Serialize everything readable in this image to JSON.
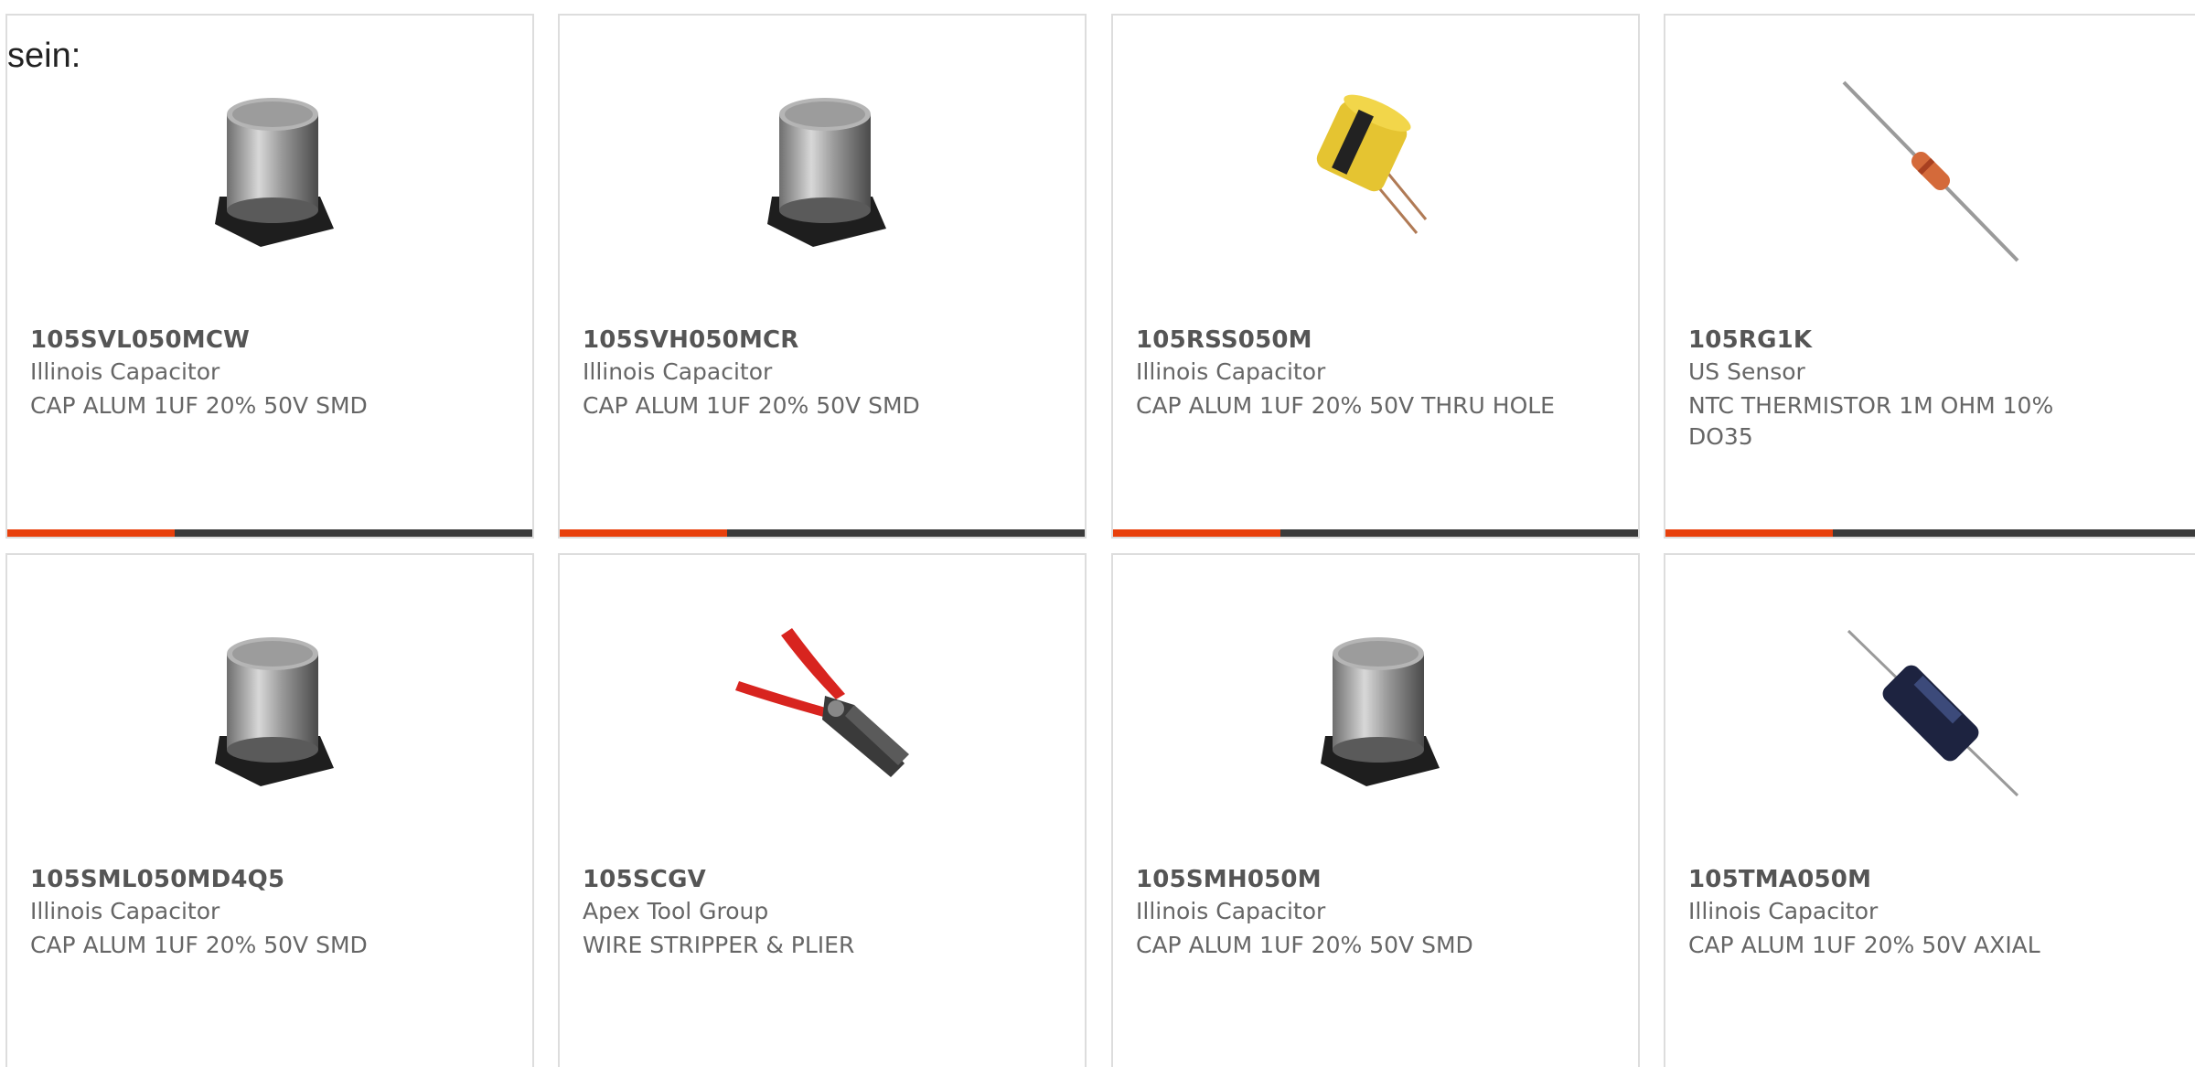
{
  "intro_text": "sein:",
  "colors": {
    "accent": "#e8400c",
    "bar_dark": "#3b3b3b",
    "border": "#dddddd"
  },
  "products": [
    {
      "part": "105SVL050MCW",
      "mfr": "Illinois Capacitor",
      "desc": "CAP ALUM 1UF 20% 50V SMD",
      "image": "smd-capacitor-image"
    },
    {
      "part": "105SVH050MCR",
      "mfr": "Illinois Capacitor",
      "desc": "CAP ALUM 1UF 20% 50V SMD",
      "image": "smd-capacitor-image"
    },
    {
      "part": "105RSS050M",
      "mfr": "Illinois Capacitor",
      "desc": "CAP ALUM 1UF 20% 50V THRU HOLE",
      "image": "radial-capacitor-image"
    },
    {
      "part": "105RG1K",
      "mfr": "US Sensor",
      "desc": "NTC THERMISTOR 1M OHM 10% DO35",
      "image": "thermistor-image"
    },
    {
      "part": "105SML050MD4Q5",
      "mfr": "Illinois Capacitor",
      "desc": "CAP ALUM 1UF 20% 50V SMD",
      "image": "smd-capacitor-image"
    },
    {
      "part": "105SCGV",
      "mfr": "Apex Tool Group",
      "desc": "WIRE STRIPPER & PLIER",
      "image": "wire-stripper-image"
    },
    {
      "part": "105SMH050M",
      "mfr": "Illinois Capacitor",
      "desc": "CAP ALUM 1UF 20% 50V SMD",
      "image": "smd-capacitor-image"
    },
    {
      "part": "105TMA050M",
      "mfr": "Illinois Capacitor",
      "desc": "CAP ALUM 1UF 20% 50V AXIAL",
      "image": "axial-capacitor-image"
    }
  ]
}
